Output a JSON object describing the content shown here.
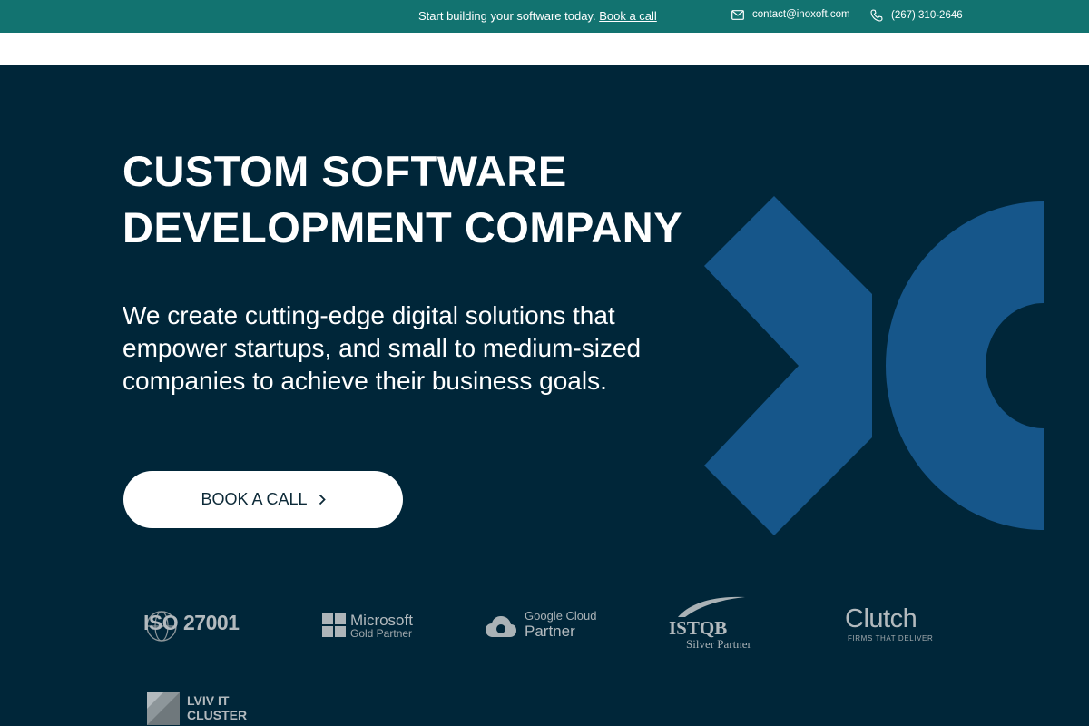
{
  "topbar": {
    "promo_text": "Start building your software today.",
    "promo_link": "Book a call",
    "email": "contact@inoxoft.com",
    "phone": "(267) 310-2646"
  },
  "hero": {
    "title_line1": "CUSTOM SOFTWARE",
    "title_line2": "DEVELOPMENT COMPANY",
    "subtitle": "We create cutting-edge digital solutions that empower startups, and small to medium-sized companies to achieve their business goals.",
    "cta_label": "BOOK A CALL"
  },
  "partners": {
    "iso": "ISO 27001",
    "microsoft_line1": "Microsoft",
    "microsoft_line2": "Gold Partner",
    "google_line1": "Google Cloud",
    "google_line2": "Partner",
    "istqb_line1": "ISTQB",
    "istqb_line2": "Silver Partner",
    "clutch_line1": "Clutch",
    "clutch_line2": "FIRMS THAT DELIVER",
    "lviv_line1": "LVIV IT",
    "lviv_line2": "CLUSTER"
  },
  "icons": {
    "email": "envelope-icon",
    "phone": "phone-icon",
    "cta_arrow": "chevron-right-icon"
  },
  "colors": {
    "topbar_bg": "#127370",
    "hero_bg": "#002639",
    "accent_shape": "#16568A",
    "cta_bg": "#FFFFFF"
  }
}
